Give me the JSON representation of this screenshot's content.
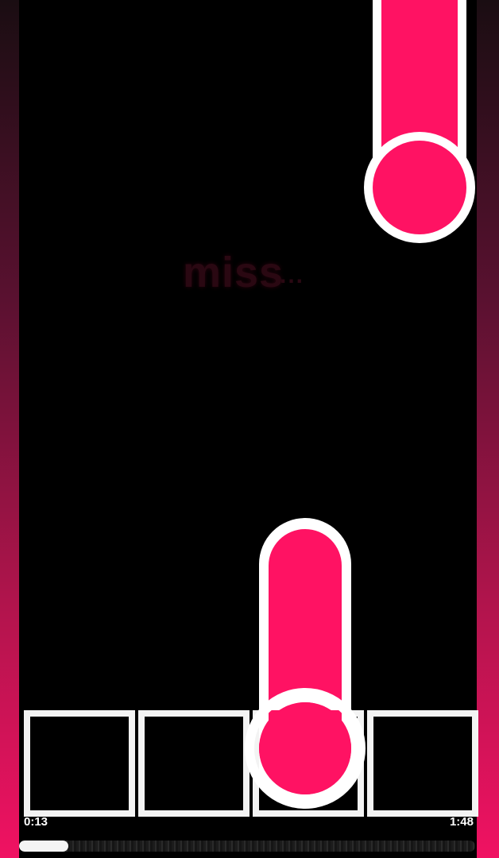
{
  "game": {
    "judgement_text": "miss",
    "judgement_suffix": "...",
    "time_current": "0:13",
    "time_total": "1:48",
    "progress_fraction": 0.108
  },
  "colors": {
    "note_fill": "#ff1263",
    "note_outline": "#ffffff",
    "receptor_outline": "#f3f3f3",
    "background": "#000000"
  },
  "icons": {
    "hold_note": "pink-capsule",
    "receptor": "square-outline"
  }
}
